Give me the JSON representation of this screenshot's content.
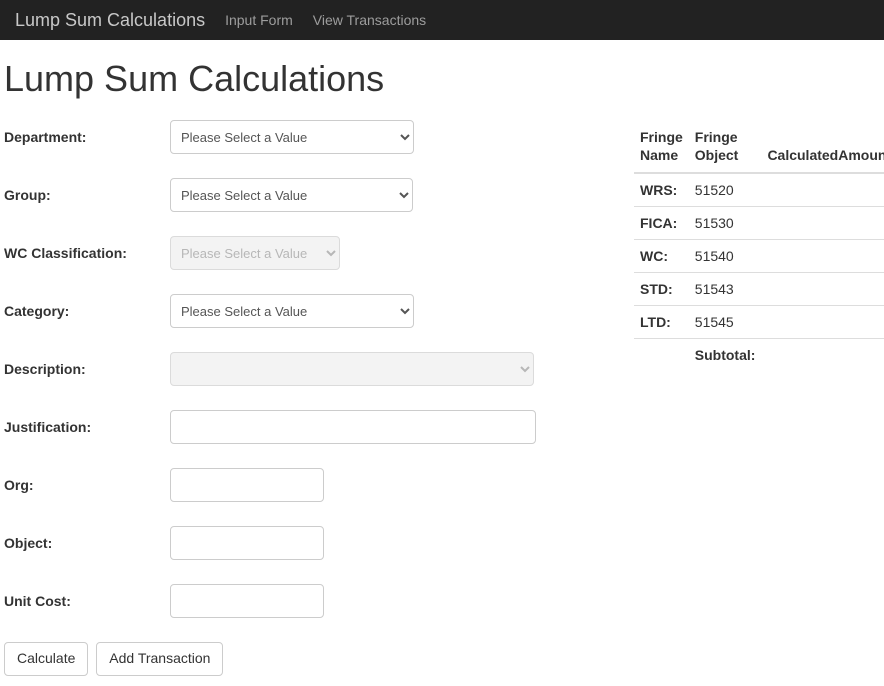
{
  "nav": {
    "brand": "Lump Sum Calculations",
    "links": [
      "Input Form",
      "View Transactions"
    ]
  },
  "page_title": "Lump Sum Calculations",
  "form": {
    "labels": {
      "department": "Department:",
      "group": "Group:",
      "wc_classification": "WC Classification:",
      "category": "Category:",
      "description": "Description:",
      "justification": "Justification:",
      "org": "Org:",
      "object": "Object:",
      "unit_cost": "Unit Cost:"
    },
    "placeholders": {
      "select": "Please Select a Value"
    },
    "values": {
      "department": "Please Select a Value",
      "group": "Please Select a Value",
      "wc_classification": "Please Select a Value",
      "category": "Please Select a Value",
      "description": "",
      "justification": "",
      "org": "",
      "object": "",
      "unit_cost": ""
    },
    "buttons": {
      "calculate": "Calculate",
      "add_transaction": "Add Transaction"
    }
  },
  "fringe": {
    "headers": {
      "name": "Fringe Name",
      "object": "Fringe Object",
      "amount": "CalculatedAmount"
    },
    "rows": [
      {
        "name": "WRS:",
        "object": "51520",
        "amount": ""
      },
      {
        "name": "FICA:",
        "object": "51530",
        "amount": ""
      },
      {
        "name": "WC:",
        "object": "51540",
        "amount": ""
      },
      {
        "name": "STD:",
        "object": "51543",
        "amount": ""
      },
      {
        "name": "LTD:",
        "object": "51545",
        "amount": ""
      }
    ],
    "subtotal_label": "Subtotal:",
    "subtotal_amount": ""
  }
}
